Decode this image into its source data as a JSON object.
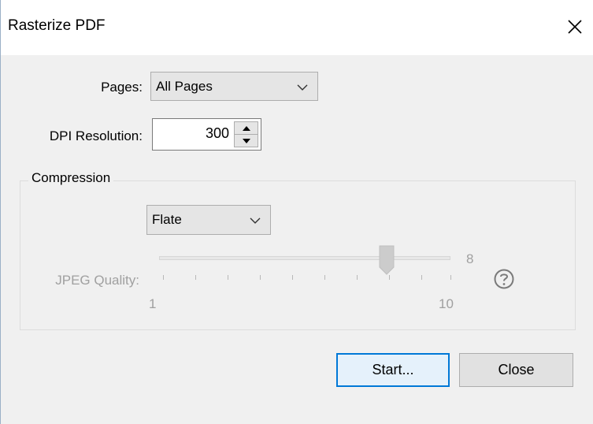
{
  "window": {
    "title": "Rasterize PDF"
  },
  "pages": {
    "label": "Pages:",
    "selected": "All Pages"
  },
  "dpi": {
    "label": "DPI Resolution:",
    "value": "300"
  },
  "compression": {
    "legend": "Compression",
    "selected": "Flate",
    "jpeg_quality": {
      "label": "JPEG Quality:",
      "min_label": "1",
      "max_label": "10",
      "value_label": "8",
      "value": 8,
      "min": 1,
      "max": 10
    }
  },
  "buttons": {
    "start": "Start...",
    "close": "Close"
  },
  "icons": {
    "close": "close-icon",
    "chevron": "chevron-down-icon",
    "spin_up": "arrow-up-icon",
    "spin_down": "arrow-down-icon",
    "help": "help-icon"
  }
}
